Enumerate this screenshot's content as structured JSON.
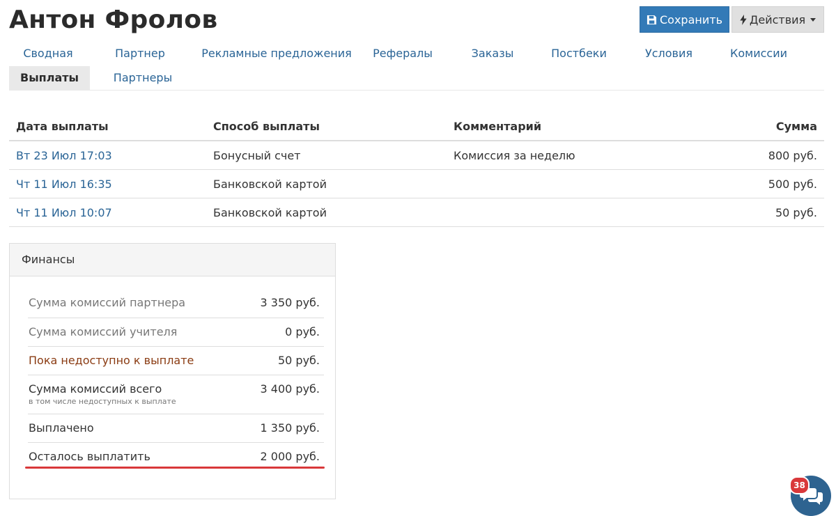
{
  "header": {
    "title": "Антон Фролов",
    "save_label": "Сохранить",
    "actions_label": "Действия"
  },
  "tabs": [
    {
      "label": "Сводная",
      "active": false
    },
    {
      "label": "Партнер",
      "active": false
    },
    {
      "label": "Рекламные предложения",
      "active": false
    },
    {
      "label": "Рефералы",
      "active": false
    },
    {
      "label": "Заказы",
      "active": false
    },
    {
      "label": "Постбеки",
      "active": false
    },
    {
      "label": "Условия",
      "active": false
    },
    {
      "label": "Комиссии",
      "active": false
    },
    {
      "label": "Выплаты",
      "active": true
    },
    {
      "label": "Партнеры",
      "active": false
    }
  ],
  "payments": {
    "columns": [
      "Дата выплаты",
      "Способ выплаты",
      "Комментарий",
      "Сумма"
    ],
    "rows": [
      {
        "date": "Вт 23 Июл 17:03",
        "method": "Бонусный счет",
        "comment": "Комиссия за неделю",
        "amount": "800 руб."
      },
      {
        "date": "Чт 11 Июл 16:35",
        "method": "Банковской картой",
        "comment": "",
        "amount": "500 руб."
      },
      {
        "date": "Чт 11 Июл 10:07",
        "method": "Банковской картой",
        "comment": "",
        "amount": "50 руб."
      }
    ]
  },
  "finances": {
    "title": "Финансы",
    "rows": [
      {
        "label": "Сумма комиссий партнера",
        "value": "3 350 руб."
      },
      {
        "label": "Сумма комиссий учителя",
        "value": "0 руб."
      },
      {
        "label": "Пока недоступно к выплате",
        "value": "50 руб."
      },
      {
        "label": "Сумма комиссий всего",
        "sub": "в том числе недоступных к выплате",
        "value": "3 400 руб."
      },
      {
        "label": "Выплачено",
        "value": "1 350 руб."
      },
      {
        "label": "Осталось выплатить",
        "value": "2 000 руб."
      }
    ]
  },
  "chat": {
    "badge": "38"
  },
  "colors": {
    "primary": "#337ab7",
    "link": "#2a6496",
    "accent_red": "#d9383a",
    "warning_text": "#8a3b12"
  }
}
